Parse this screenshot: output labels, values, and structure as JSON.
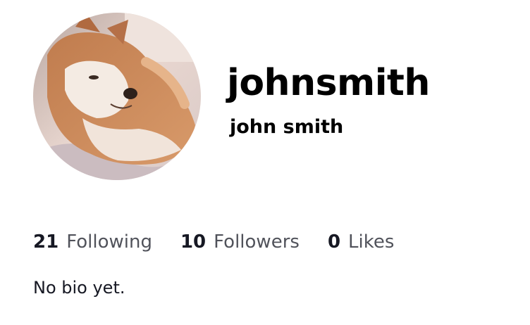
{
  "profile": {
    "username": "johnsmith",
    "nickname": "john smith",
    "avatar_icon": "avatar-photo-shiba-dog",
    "bio": "No bio yet."
  },
  "stats": {
    "following": {
      "count": "21",
      "label": "Following"
    },
    "followers": {
      "count": "10",
      "label": "Followers"
    },
    "likes": {
      "count": "0",
      "label": "Likes"
    }
  },
  "colors": {
    "text_primary": "#161823",
    "text_secondary": "#161823BF",
    "username": "#000000"
  }
}
